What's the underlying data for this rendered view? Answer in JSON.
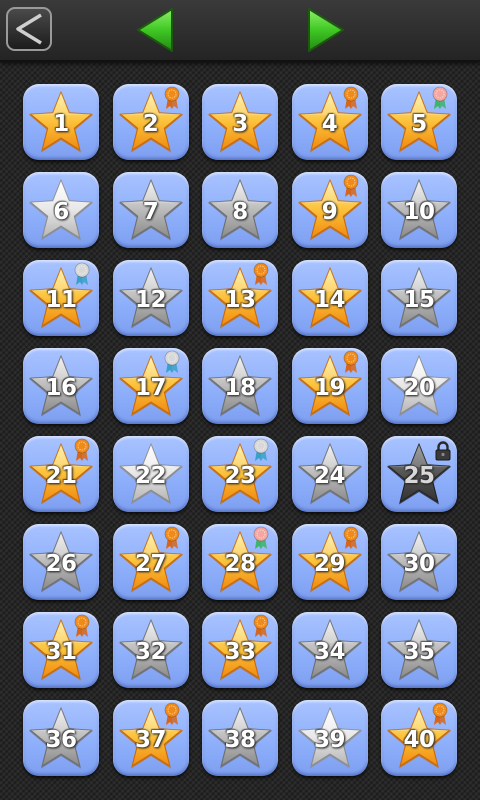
{
  "header": {
    "back_icon": "back-chevron-icon",
    "prev_icon": "triangle-left-icon",
    "next_icon": "triangle-right-icon",
    "arrow_color": "#4cd32a"
  },
  "colors": {
    "gold": "#f5a61c",
    "silver": "#c2c2c2",
    "white": "#e6e6e6",
    "locked": "#4a4a4a",
    "tile": "#8fb0fb",
    "medal_bronze": "#f08a18",
    "medal_silver": "#d8d8d8",
    "medal_pink": "#f4a6a0"
  },
  "levels": [
    {
      "number": "1",
      "star": "gold",
      "medal": null,
      "locked": false
    },
    {
      "number": "2",
      "star": "gold",
      "medal": "bronze",
      "locked": false
    },
    {
      "number": "3",
      "star": "gold",
      "medal": null,
      "locked": false
    },
    {
      "number": "4",
      "star": "gold",
      "medal": "bronze",
      "locked": false
    },
    {
      "number": "5",
      "star": "gold",
      "medal": "pink",
      "locked": false
    },
    {
      "number": "6",
      "star": "white",
      "medal": null,
      "locked": false
    },
    {
      "number": "7",
      "star": "silver",
      "medal": null,
      "locked": false
    },
    {
      "number": "8",
      "star": "silver",
      "medal": null,
      "locked": false
    },
    {
      "number": "9",
      "star": "gold",
      "medal": "bronze",
      "locked": false
    },
    {
      "number": "10",
      "star": "silver",
      "medal": null,
      "locked": false
    },
    {
      "number": "11",
      "star": "gold",
      "medal": "silver",
      "locked": false
    },
    {
      "number": "12",
      "star": "silver",
      "medal": null,
      "locked": false
    },
    {
      "number": "13",
      "star": "gold",
      "medal": "bronze",
      "locked": false
    },
    {
      "number": "14",
      "star": "gold",
      "medal": null,
      "locked": false
    },
    {
      "number": "15",
      "star": "silver",
      "medal": null,
      "locked": false
    },
    {
      "number": "16",
      "star": "silver",
      "medal": null,
      "locked": false
    },
    {
      "number": "17",
      "star": "gold",
      "medal": "silver",
      "locked": false
    },
    {
      "number": "18",
      "star": "silver",
      "medal": null,
      "locked": false
    },
    {
      "number": "19",
      "star": "gold",
      "medal": "bronze",
      "locked": false
    },
    {
      "number": "20",
      "star": "white",
      "medal": null,
      "locked": false
    },
    {
      "number": "21",
      "star": "gold",
      "medal": "bronze",
      "locked": false
    },
    {
      "number": "22",
      "star": "white",
      "medal": null,
      "locked": false
    },
    {
      "number": "23",
      "star": "gold",
      "medal": "silver",
      "locked": false
    },
    {
      "number": "24",
      "star": "silver",
      "medal": null,
      "locked": false
    },
    {
      "number": "25",
      "star": "locked",
      "medal": null,
      "locked": true
    },
    {
      "number": "26",
      "star": "silver",
      "medal": null,
      "locked": false
    },
    {
      "number": "27",
      "star": "gold",
      "medal": "bronze",
      "locked": false
    },
    {
      "number": "28",
      "star": "gold",
      "medal": "pink",
      "locked": false
    },
    {
      "number": "29",
      "star": "gold",
      "medal": "bronze",
      "locked": false
    },
    {
      "number": "30",
      "star": "silver",
      "medal": null,
      "locked": false
    },
    {
      "number": "31",
      "star": "gold",
      "medal": "bronze",
      "locked": false
    },
    {
      "number": "32",
      "star": "silver",
      "medal": null,
      "locked": false
    },
    {
      "number": "33",
      "star": "gold",
      "medal": "bronze",
      "locked": false
    },
    {
      "number": "34",
      "star": "silver",
      "medal": null,
      "locked": false
    },
    {
      "number": "35",
      "star": "silver",
      "medal": null,
      "locked": false
    },
    {
      "number": "36",
      "star": "silver",
      "medal": null,
      "locked": false
    },
    {
      "number": "37",
      "star": "gold",
      "medal": "bronze",
      "locked": false
    },
    {
      "number": "38",
      "star": "silver",
      "medal": null,
      "locked": false
    },
    {
      "number": "39",
      "star": "white",
      "medal": null,
      "locked": false
    },
    {
      "number": "40",
      "star": "gold",
      "medal": "bronze",
      "locked": false
    }
  ]
}
